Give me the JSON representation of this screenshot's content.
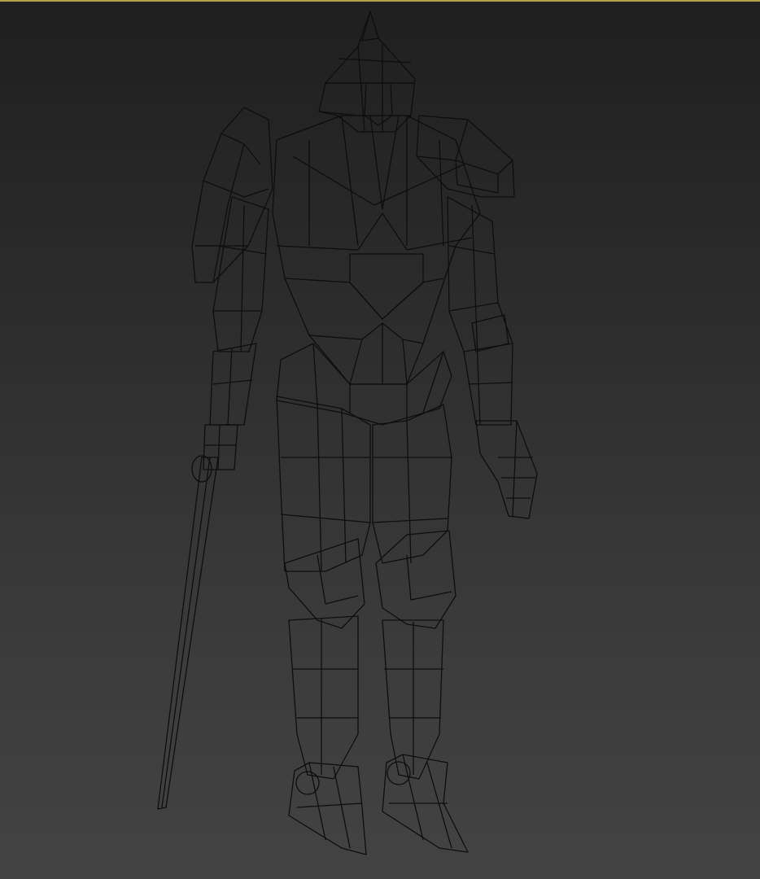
{
  "viewport": {
    "active_border_color": "#b8a24a",
    "background_top": "#1f1f1f",
    "background_bottom": "#434343",
    "shading_mode": "shaded-wireframe",
    "mesh_color": "#7a7a7a",
    "edge_color": "#0e0e0e"
  },
  "model": {
    "parts": [
      "helmet",
      "torso",
      "right-shoulder-shield",
      "left-shoulder-pad",
      "right-arm",
      "left-arm",
      "left-hand",
      "pelvis",
      "right-leg",
      "left-leg",
      "right-foot",
      "left-foot",
      "sword"
    ]
  }
}
